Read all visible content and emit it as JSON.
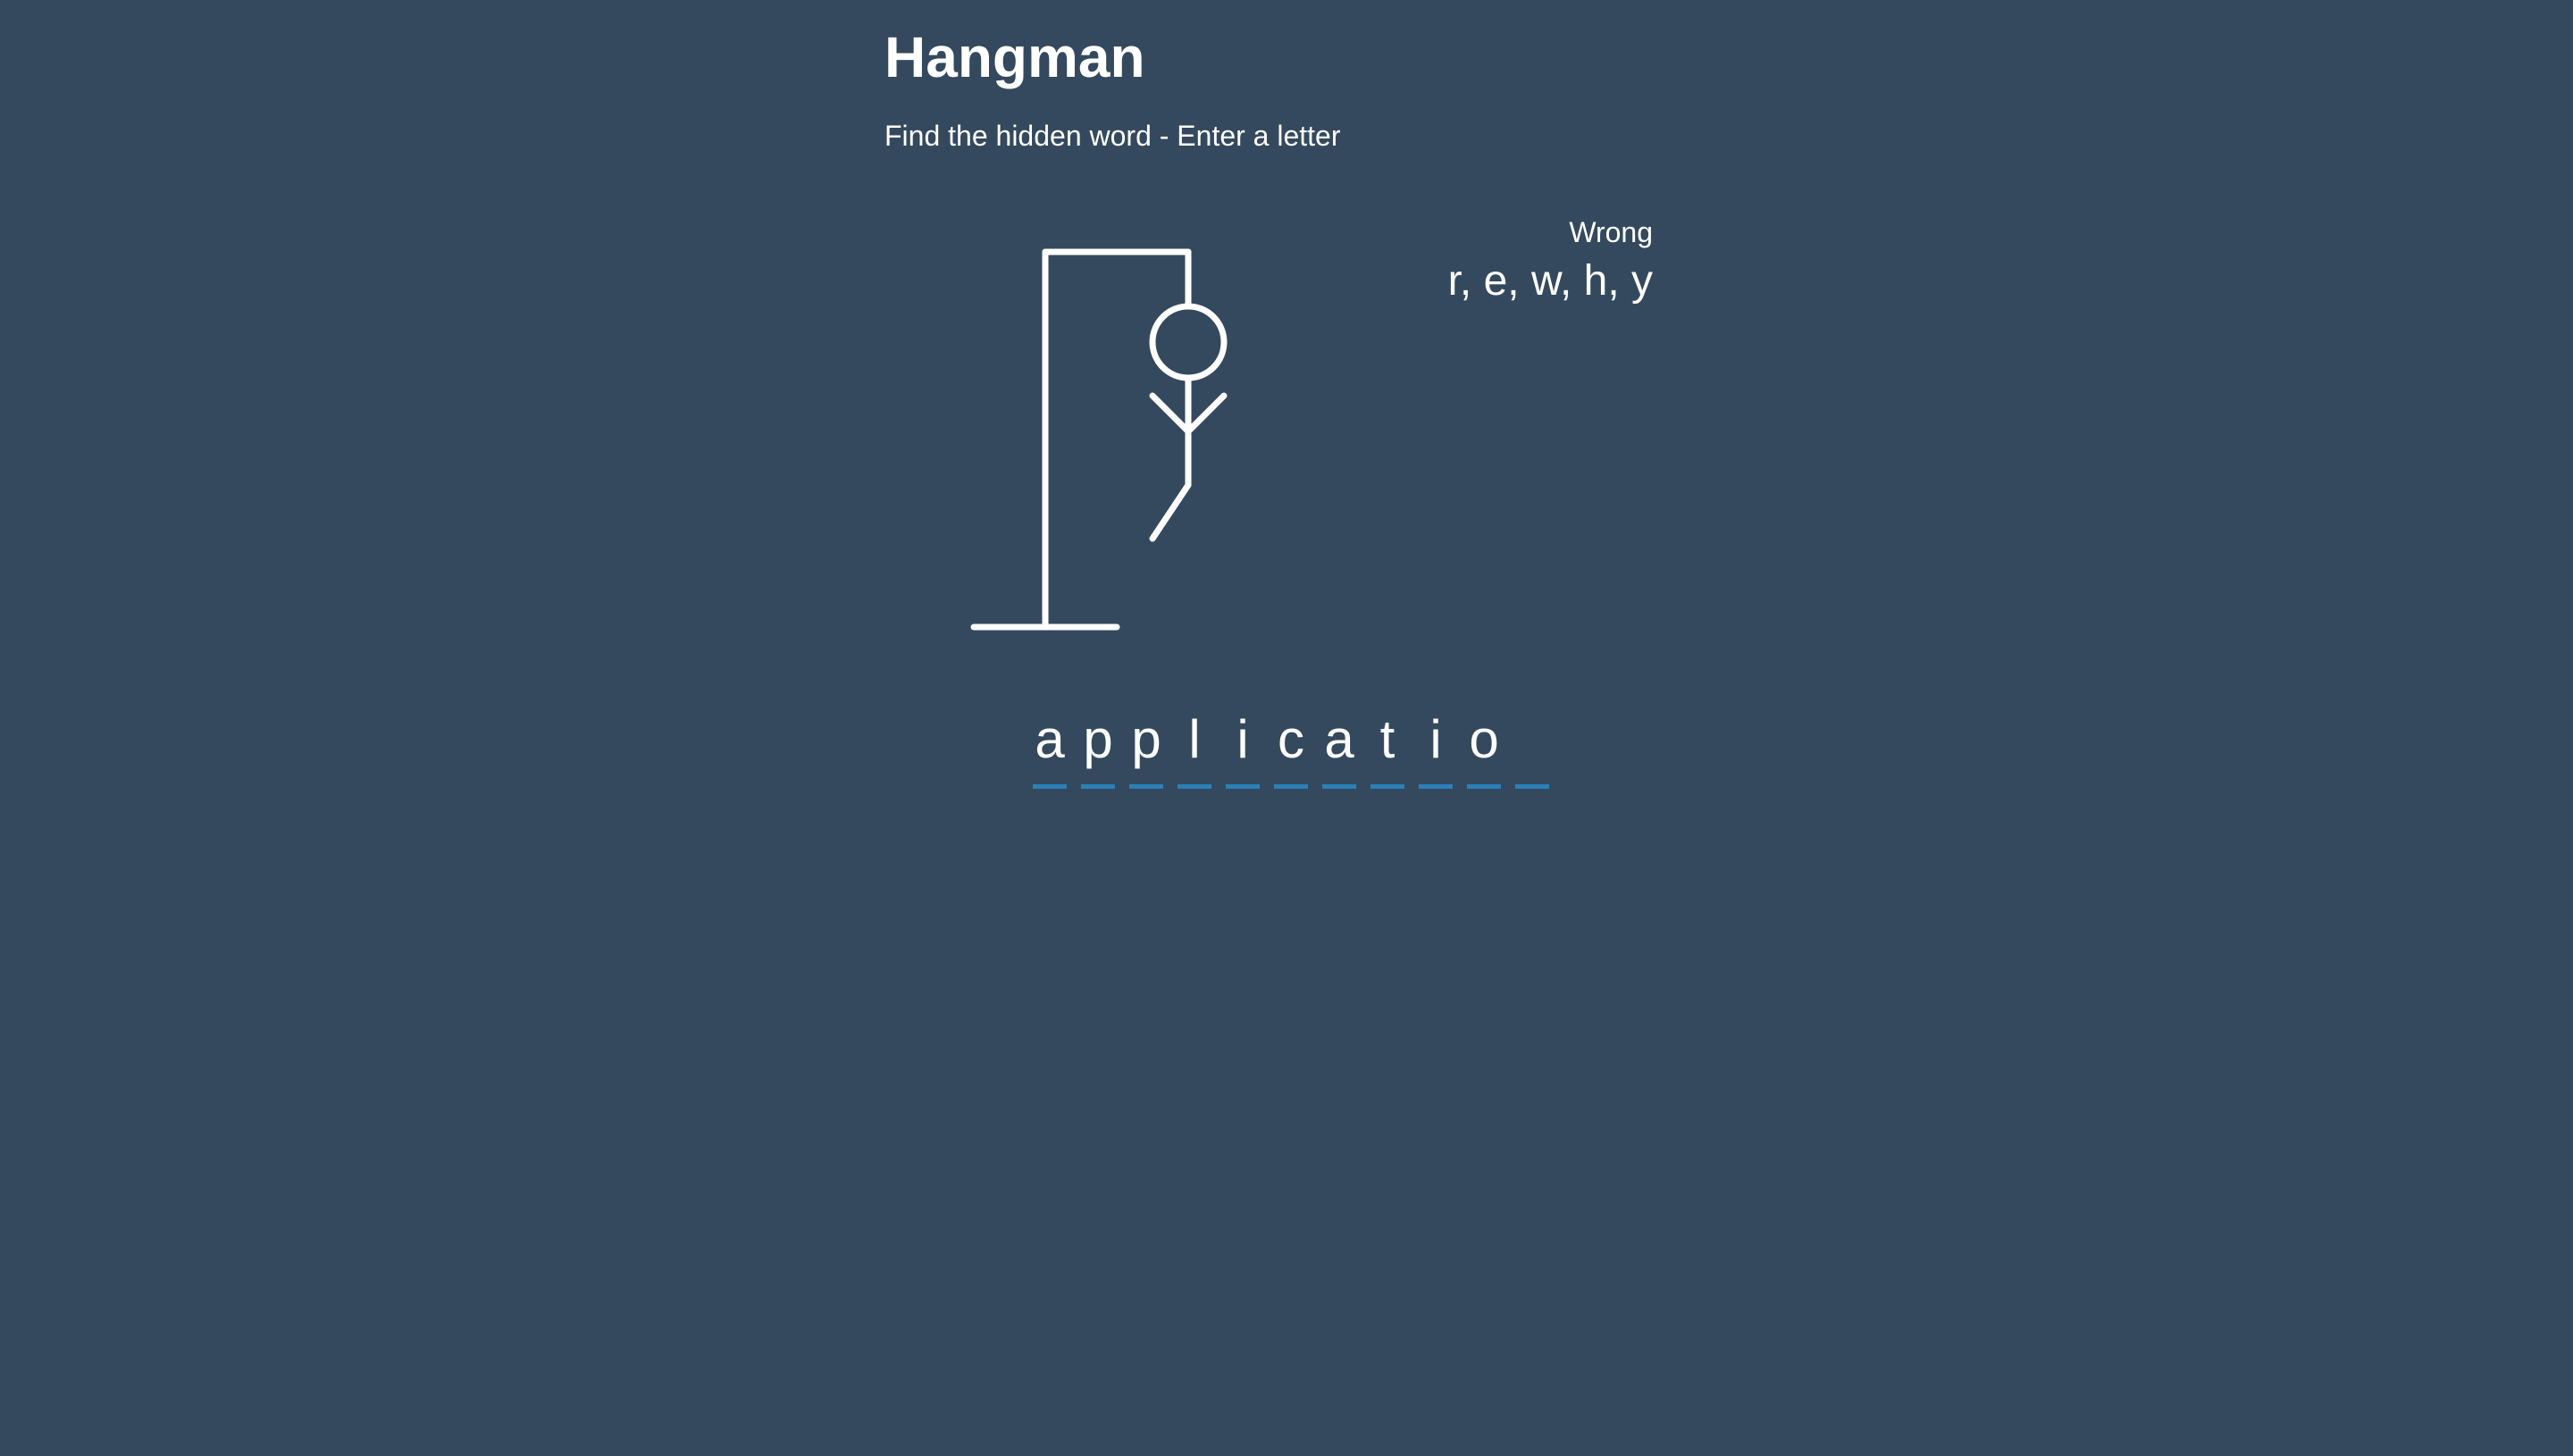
{
  "header": {
    "title": "Hangman",
    "subtitle": "Find the hidden word - Enter a letter"
  },
  "wrong": {
    "label": "Wrong",
    "letters": "r, e, w, h, y"
  },
  "word": {
    "letters": [
      "a",
      "p",
      "p",
      "l",
      "i",
      "c",
      "a",
      "t",
      "i",
      "o",
      ""
    ]
  },
  "hangman": {
    "drawn_parts": [
      "gallows",
      "head",
      "body",
      "left-arm",
      "right-arm",
      "left-leg"
    ],
    "mistakes": 5
  },
  "colors": {
    "background": "#34495e",
    "text": "#ffffff",
    "letter_underline": "#2980b9"
  }
}
